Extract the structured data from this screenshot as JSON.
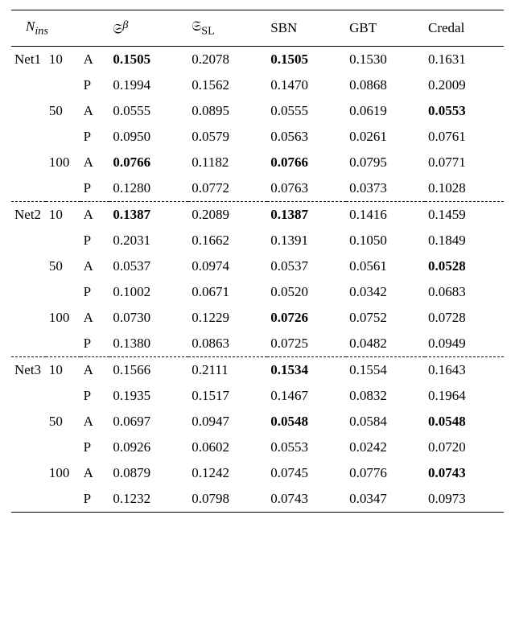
{
  "chart_data": {
    "type": "table",
    "title": "",
    "header": {
      "nins_html": "<i>N</i><sub><i>ins</i></sub>",
      "cols": [
        "𝔖<sup><i>β</i></sup>",
        "𝔖<sub>SL</sub>",
        "SBN",
        "GBT",
        "Credal"
      ]
    },
    "groups": [
      {
        "net": "Net1",
        "rows": [
          {
            "n": "10",
            "ap": "A",
            "v": [
              "0.1505",
              "0.2078",
              "0.1505",
              "0.1530",
              "0.1631"
            ],
            "bold": [
              0,
              2
            ]
          },
          {
            "n": "",
            "ap": "P",
            "v": [
              "0.1994",
              "0.1562",
              "0.1470",
              "0.0868",
              "0.2009"
            ],
            "bold": []
          },
          {
            "n": "50",
            "ap": "A",
            "v": [
              "0.0555",
              "0.0895",
              "0.0555",
              "0.0619",
              "0.0553"
            ],
            "bold": [
              4
            ]
          },
          {
            "n": "",
            "ap": "P",
            "v": [
              "0.0950",
              "0.0579",
              "0.0563",
              "0.0261",
              "0.0761"
            ],
            "bold": []
          },
          {
            "n": "100",
            "ap": "A",
            "v": [
              "0.0766",
              "0.1182",
              "0.0766",
              "0.0795",
              "0.0771"
            ],
            "bold": [
              0,
              2
            ]
          },
          {
            "n": "",
            "ap": "P",
            "v": [
              "0.1280",
              "0.0772",
              "0.0763",
              "0.0373",
              "0.1028"
            ],
            "bold": []
          }
        ]
      },
      {
        "net": "Net2",
        "rows": [
          {
            "n": "10",
            "ap": "A",
            "v": [
              "0.1387",
              "0.2089",
              "0.1387",
              "0.1416",
              "0.1459"
            ],
            "bold": [
              0,
              2
            ]
          },
          {
            "n": "",
            "ap": "P",
            "v": [
              "0.2031",
              "0.1662",
              "0.1391",
              "0.1050",
              "0.1849"
            ],
            "bold": []
          },
          {
            "n": "50",
            "ap": "A",
            "v": [
              "0.0537",
              "0.0974",
              "0.0537",
              "0.0561",
              "0.0528"
            ],
            "bold": [
              4
            ]
          },
          {
            "n": "",
            "ap": "P",
            "v": [
              "0.1002",
              "0.0671",
              "0.0520",
              "0.0342",
              "0.0683"
            ],
            "bold": []
          },
          {
            "n": "100",
            "ap": "A",
            "v": [
              "0.0730",
              "0.1229",
              "0.0726",
              "0.0752",
              "0.0728"
            ],
            "bold": [
              2
            ]
          },
          {
            "n": "",
            "ap": "P",
            "v": [
              "0.1380",
              "0.0863",
              "0.0725",
              "0.0482",
              "0.0949"
            ],
            "bold": []
          }
        ]
      },
      {
        "net": "Net3",
        "rows": [
          {
            "n": "10",
            "ap": "A",
            "v": [
              "0.1566",
              "0.2111",
              "0.1534",
              "0.1554",
              "0.1643"
            ],
            "bold": [
              2
            ]
          },
          {
            "n": "",
            "ap": "P",
            "v": [
              "0.1935",
              "0.1517",
              "0.1467",
              "0.0832",
              "0.1964"
            ],
            "bold": []
          },
          {
            "n": "50",
            "ap": "A",
            "v": [
              "0.0697",
              "0.0947",
              "0.0548",
              "0.0584",
              "0.0548"
            ],
            "bold": [
              2,
              4
            ]
          },
          {
            "n": "",
            "ap": "P",
            "v": [
              "0.0926",
              "0.0602",
              "0.0553",
              "0.0242",
              "0.0720"
            ],
            "bold": []
          },
          {
            "n": "100",
            "ap": "A",
            "v": [
              "0.0879",
              "0.1242",
              "0.0745",
              "0.0776",
              "0.0743"
            ],
            "bold": [
              4
            ]
          },
          {
            "n": "",
            "ap": "P",
            "v": [
              "0.1232",
              "0.0798",
              "0.0743",
              "0.0347",
              "0.0973"
            ],
            "bold": []
          }
        ]
      }
    ]
  }
}
